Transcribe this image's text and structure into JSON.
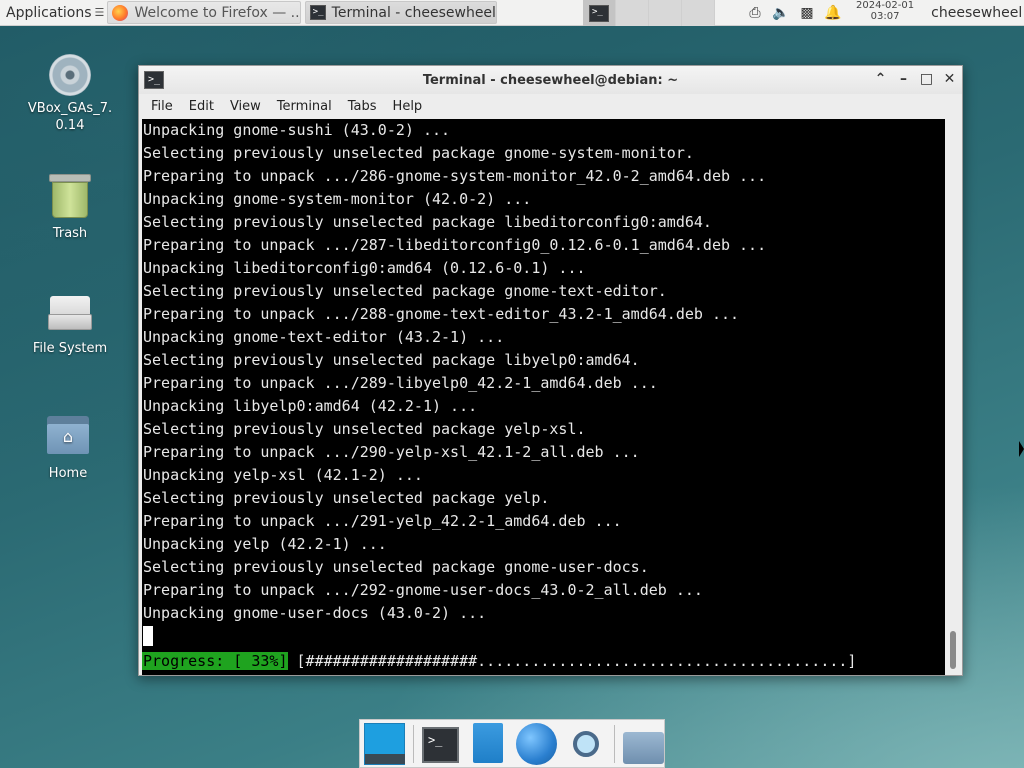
{
  "top_panel": {
    "apps_label": "Applications",
    "apps_suffix": "☰",
    "tasks": [
      {
        "label": "Welcome to Firefox — ...",
        "icon": "firefox-icon"
      },
      {
        "label": "Terminal - cheesewheel...",
        "icon": "terminal-icon"
      }
    ],
    "clock_date": "2024-02-01",
    "clock_time": "03:07",
    "user": "cheesewheel"
  },
  "desktop_icons": [
    {
      "label": "VBox_GAs_7.\n0.14",
      "icon": "cd-rom-icon"
    },
    {
      "label": "Trash",
      "icon": "trash-icon"
    },
    {
      "label": "File System",
      "icon": "drive-icon"
    },
    {
      "label": "Home",
      "icon": "home-folder-icon"
    }
  ],
  "window": {
    "title": "Terminal - cheesewheel@debian: ~",
    "menu": [
      "File",
      "Edit",
      "View",
      "Terminal",
      "Tabs",
      "Help"
    ]
  },
  "terminal": {
    "lines": [
      "Unpacking gnome-sushi (43.0-2) ...",
      "Selecting previously unselected package gnome-system-monitor.",
      "Preparing to unpack .../286-gnome-system-monitor_42.0-2_amd64.deb ...",
      "Unpacking gnome-system-monitor (42.0-2) ...",
      "Selecting previously unselected package libeditorconfig0:amd64.",
      "Preparing to unpack .../287-libeditorconfig0_0.12.6-0.1_amd64.deb ...",
      "Unpacking libeditorconfig0:amd64 (0.12.6-0.1) ...",
      "Selecting previously unselected package gnome-text-editor.",
      "Preparing to unpack .../288-gnome-text-editor_43.2-1_amd64.deb ...",
      "Unpacking gnome-text-editor (43.2-1) ...",
      "Selecting previously unselected package libyelp0:amd64.",
      "Preparing to unpack .../289-libyelp0_42.2-1_amd64.deb ...",
      "Unpacking libyelp0:amd64 (42.2-1) ...",
      "Selecting previously unselected package yelp-xsl.",
      "Preparing to unpack .../290-yelp-xsl_42.1-2_all.deb ...",
      "Unpacking yelp-xsl (42.1-2) ...",
      "Selecting previously unselected package yelp.",
      "Preparing to unpack .../291-yelp_42.2-1_amd64.deb ...",
      "Unpacking yelp (42.2-1) ...",
      "Selecting previously unselected package gnome-user-docs.",
      "Preparing to unpack .../292-gnome-user-docs_43.0-2_all.deb ...",
      "Unpacking gnome-user-docs (43.0-2) ..."
    ],
    "progress_label": "Progress: [ 33%]",
    "progress_bar": " [###################.........................................]",
    "progress_percent": 33
  },
  "colors": {
    "progress_green": "#1fa31f",
    "terminal_bg": "#000000",
    "terminal_fg": "#e8e8e8"
  },
  "dock": [
    "show-desktop-icon",
    "terminal-icon",
    "file-manager-icon",
    "web-browser-icon",
    "app-finder-icon",
    "folder-icon"
  ]
}
